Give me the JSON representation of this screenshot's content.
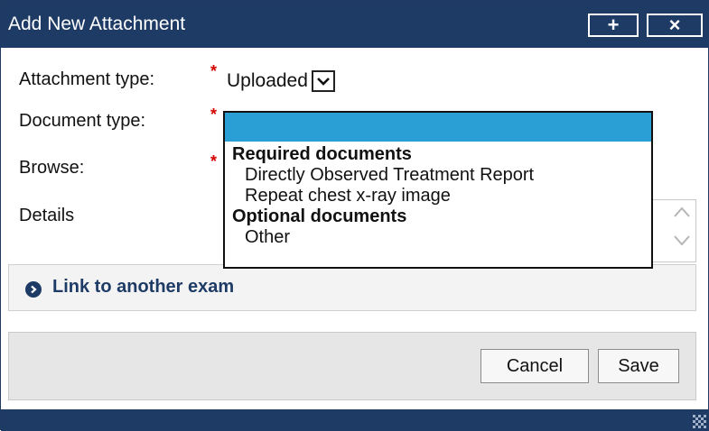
{
  "dialog": {
    "title": "Add New Attachment",
    "add_glyph": "+",
    "close_glyph": "×",
    "icons": {
      "add": "plus-icon",
      "close": "close-icon"
    }
  },
  "form": {
    "attachment_type_label": "Attachment type:",
    "attachment_type_value": "Uploaded",
    "document_type_label": "Document type:",
    "document_type_value": "",
    "browse_label": "Browse:",
    "details_label": "Details",
    "required_mark": "*"
  },
  "dropdown": {
    "groups": [
      {
        "label": "Required documents",
        "options": [
          "Directly Observed Treatment Report",
          "Repeat chest x-ray image"
        ]
      },
      {
        "label": "Optional documents",
        "options": [
          "Other"
        ]
      }
    ]
  },
  "link_panel": {
    "label": "Link to another exam",
    "icon": "circle-chevron-right-icon"
  },
  "buttons": {
    "cancel": "Cancel",
    "save": "Save"
  },
  "colors": {
    "titlebar": "#1e3b66",
    "highlight": "#2a9fd6",
    "required": "#d40000",
    "link": "#1e3b66"
  }
}
